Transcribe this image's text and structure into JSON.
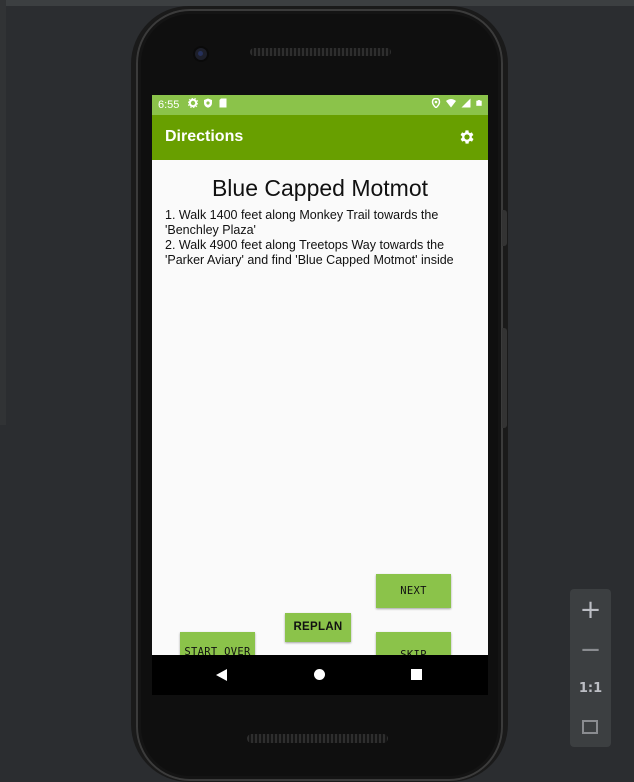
{
  "status_bar": {
    "time": "6:55",
    "left_icons": [
      "gear-icon",
      "shield-icon",
      "sim-card-icon"
    ],
    "right_icons": [
      "location-icon",
      "wifi-icon",
      "signal-icon",
      "battery-icon"
    ]
  },
  "app_bar": {
    "title": "Directions",
    "settings_icon": "gear-icon"
  },
  "content": {
    "destination": "Blue Capped Motmot",
    "steps": [
      " 1. Walk 1400 feet along Monkey Trail towards the 'Benchley Plaza'",
      " 2. Walk 4900 feet along Treetops Way towards the 'Parker Aviary' and find 'Blue Capped Motmot' inside"
    ]
  },
  "buttons": {
    "next": "NEXT",
    "replan": "REPLAN",
    "start_over": "START OVER",
    "skip": "SKIP"
  },
  "nav_bar": {
    "back_icon": "back-triangle-icon",
    "home_icon": "home-circle-icon",
    "recents_icon": "recents-square-icon"
  },
  "zoom_controls": {
    "zoom_in": "+",
    "zoom_out": "−",
    "actual_size": "1:1",
    "fit_icon": "fit-screen-icon"
  },
  "colors": {
    "status_bar": "#8bc34a",
    "app_bar": "#689f00",
    "button": "#8bc34a",
    "background": "#2b2d30"
  }
}
